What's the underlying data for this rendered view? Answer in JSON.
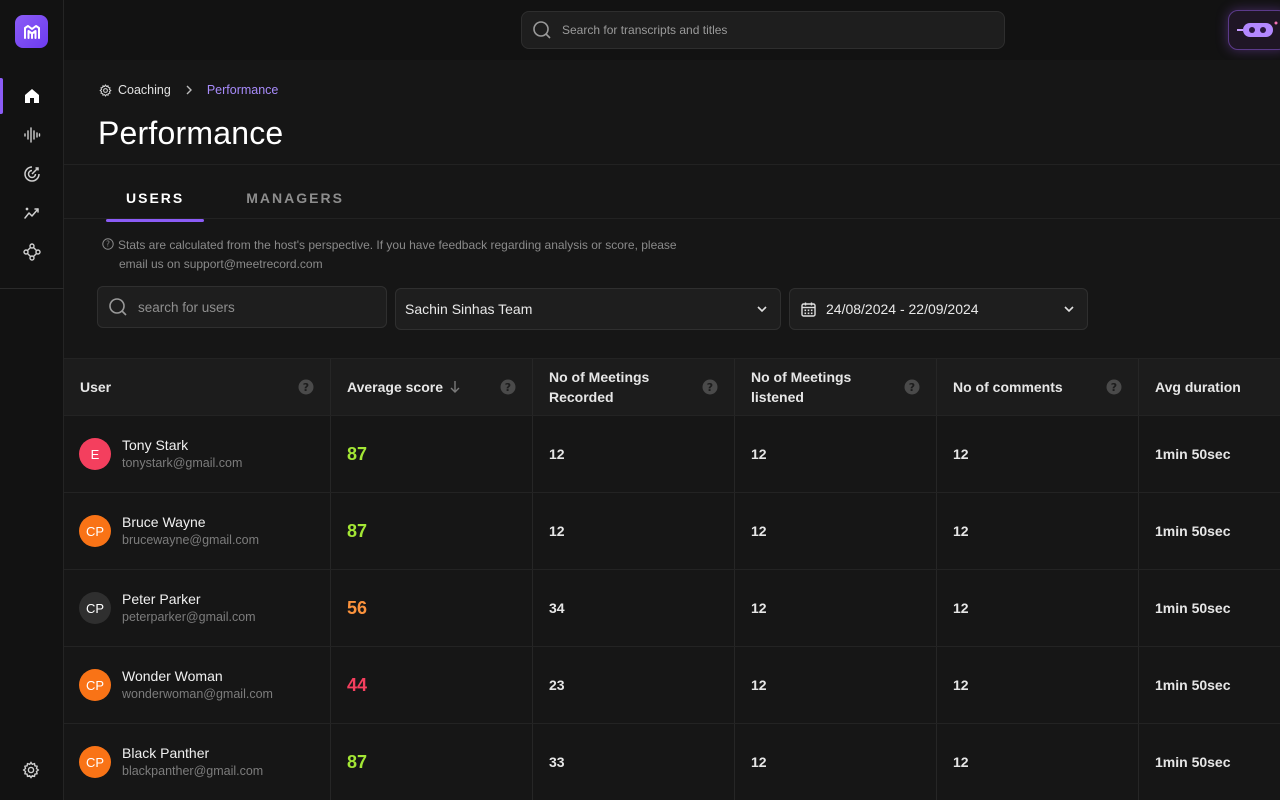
{
  "topbar": {
    "search_placeholder": "Search for transcripts and titles"
  },
  "sidebar": {
    "items": [
      {
        "icon": "home-icon",
        "active": true
      },
      {
        "icon": "soundwave-icon",
        "active": false
      },
      {
        "icon": "target-icon",
        "active": false
      },
      {
        "icon": "trending-icon",
        "active": false
      },
      {
        "icon": "network-icon",
        "active": false
      }
    ],
    "bottom_icon": "settings-gear-icon"
  },
  "breadcrumb": {
    "root": "Coaching",
    "current": "Performance"
  },
  "page_title": "Performance",
  "tabs": [
    {
      "label": "USERS",
      "active": true
    },
    {
      "label": "MANAGERS",
      "active": false
    }
  ],
  "info": {
    "line1": "Stats are calculated from the host's perspective. If you have feedback regarding analysis or score, please",
    "line2": "email us on support@meetrecord.com"
  },
  "filters": {
    "user_search_placeholder": "search for users",
    "team": "Sachin Sinhas Team",
    "date_range": "24/08/2024 - 22/09/2024"
  },
  "table": {
    "headers": {
      "user": "User",
      "avg_score": "Average score",
      "meetings_recorded_1": "No of Meetings",
      "meetings_recorded_2": "Recorded",
      "meetings_listened_1": "No of Meetings",
      "meetings_listened_2": "listened",
      "comments": "No of comments",
      "avg_duration": "Avg duration"
    },
    "rows": [
      {
        "initials": "E",
        "name": "Tony Stark",
        "email": "tonystark@gmail.com",
        "score": "87",
        "recorded": "12",
        "listened": "12",
        "comments": "12",
        "duration": "1min 50sec"
      },
      {
        "initials": "CP",
        "name": "Bruce Wayne",
        "email": "brucewayne@gmail.com",
        "score": "87",
        "recorded": "12",
        "listened": "12",
        "comments": "12",
        "duration": "1min 50sec"
      },
      {
        "initials": "CP",
        "name": "Peter Parker",
        "email": "peterparker@gmail.com",
        "score": "56",
        "recorded": "34",
        "listened": "12",
        "comments": "12",
        "duration": "1min 50sec"
      },
      {
        "initials": "CP",
        "name": "Wonder Woman",
        "email": "wonderwoman@gmail.com",
        "score": "44",
        "recorded": "23",
        "listened": "12",
        "comments": "12",
        "duration": "1min 50sec"
      },
      {
        "initials": "CP",
        "name": "Black Panther",
        "email": "blackpanther@gmail.com",
        "score": "87",
        "recorded": "33",
        "listened": "12",
        "comments": "12",
        "duration": "1min 50sec"
      }
    ]
  },
  "colors": {
    "accent": "#8b5cf6",
    "score_high": "#a3e635",
    "score_mid": "#fb923c",
    "score_low": "#f43f5e",
    "avatar_red": "#f43f5e",
    "avatar_orange": "#f97316",
    "avatar_dark": "#2f2f2f"
  }
}
